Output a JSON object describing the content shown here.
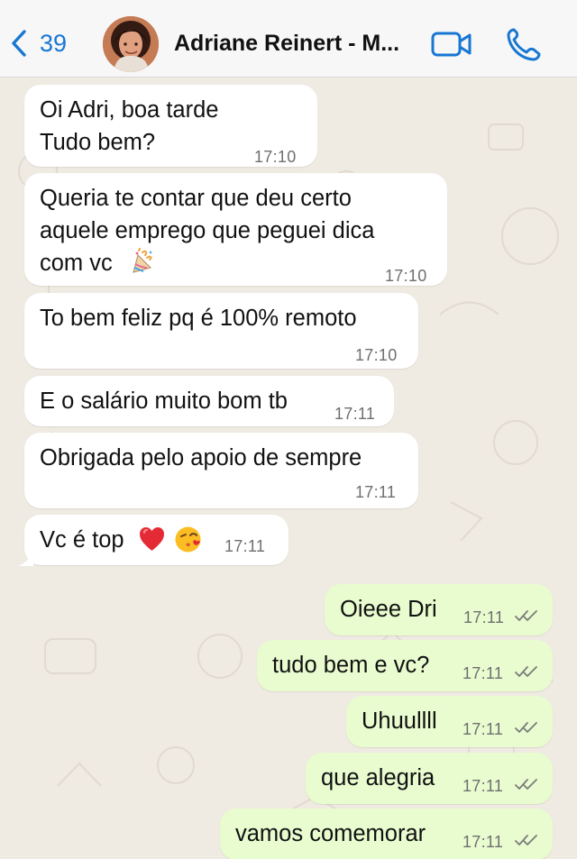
{
  "header": {
    "back_count": "39",
    "contact_name": "Adriane Reinert - M..."
  },
  "messages": [
    {
      "side": "incoming",
      "lines": [
        "Oi Adri, boa tarde",
        "Tudo bem?"
      ],
      "time": "17:10"
    },
    {
      "side": "incoming",
      "lines": [
        "Queria te contar que deu certo",
        "aquele emprego que peguei dica",
        "com vc"
      ],
      "time": "17:10"
    },
    {
      "side": "incoming",
      "lines": [
        "To bem feliz pq é 100% remoto"
      ],
      "time": "17:10"
    },
    {
      "side": "incoming",
      "lines": [
        "E o salário muito bom tb"
      ],
      "time": "17:11"
    },
    {
      "side": "incoming",
      "lines": [
        "Obrigada pelo apoio de sempre"
      ],
      "time": "17:11"
    },
    {
      "side": "incoming",
      "lines": [
        "Vc é top"
      ],
      "time": "17:11"
    },
    {
      "side": "outgoing",
      "lines": [
        "Oieee Dri"
      ],
      "time": "17:11"
    },
    {
      "side": "outgoing",
      "lines": [
        "tudo bem e vc?"
      ],
      "time": "17:11"
    },
    {
      "side": "outgoing",
      "lines": [
        "Uhuullll"
      ],
      "time": "17:11"
    },
    {
      "side": "outgoing",
      "lines": [
        "que alegria"
      ],
      "time": "17:11"
    },
    {
      "side": "outgoing",
      "lines": [
        "vamos comemorar"
      ],
      "time": "17:11"
    }
  ],
  "icons": {
    "back": "chevron-left-icon",
    "video": "video-call-icon",
    "phone": "phone-icon",
    "confetti": "party-popper-icon",
    "heart": "red-heart-icon",
    "kiss": "face-blowing-kiss-icon",
    "read": "double-check-icon"
  },
  "colors": {
    "accent": "#1877d3",
    "incoming_bubble": "#ffffff",
    "outgoing_bubble": "#e8fccf",
    "chat_background": "#efeae2",
    "heart": "#e42b35",
    "kiss": "#fbbd22"
  }
}
